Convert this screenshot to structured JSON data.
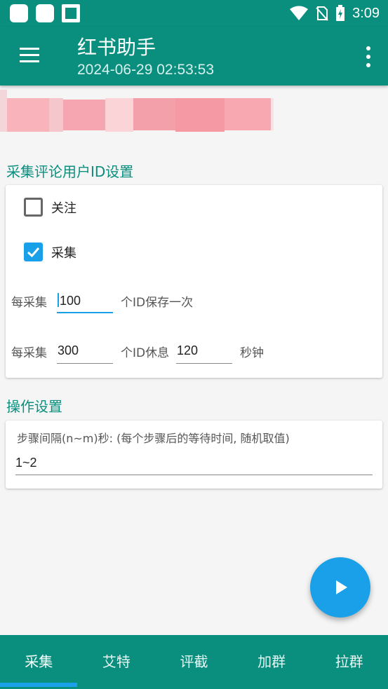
{
  "status_bar": {
    "time": "3:09"
  },
  "app_bar": {
    "title": "红书助手",
    "subtitle": "2024-06-29 02:53:53",
    "menu_icon": "hamburger-menu-icon",
    "overflow_icon": "more-vertical-icon"
  },
  "sections": {
    "collect_title": "采集评论用户ID设置",
    "operation_title": "操作设置"
  },
  "collect": {
    "follow": {
      "label": "关注",
      "checked": false
    },
    "collect": {
      "label": "采集",
      "checked": true
    },
    "save_row": {
      "prefix": "每采集",
      "value": "100",
      "suffix": "个ID保存一次"
    },
    "rest_row": {
      "prefix": "每采集",
      "value": "300",
      "middle": "个ID休息",
      "rest_value": "120",
      "suffix": "秒钟"
    }
  },
  "operation": {
    "step_desc": "步骤间隔(n~m)秒: (每个步骤后的等待时间, 随机取值)",
    "step_value": "1~2"
  },
  "fab": {
    "icon": "play-icon"
  },
  "bottom_nav": {
    "tabs": [
      {
        "label": "采集",
        "active": true
      },
      {
        "label": "艾特",
        "active": false
      },
      {
        "label": "评截",
        "active": false
      },
      {
        "label": "加群",
        "active": false
      },
      {
        "label": "拉群",
        "active": false
      }
    ]
  },
  "colors": {
    "primary": "#0a8f7f",
    "accent": "#1aa0e8"
  }
}
